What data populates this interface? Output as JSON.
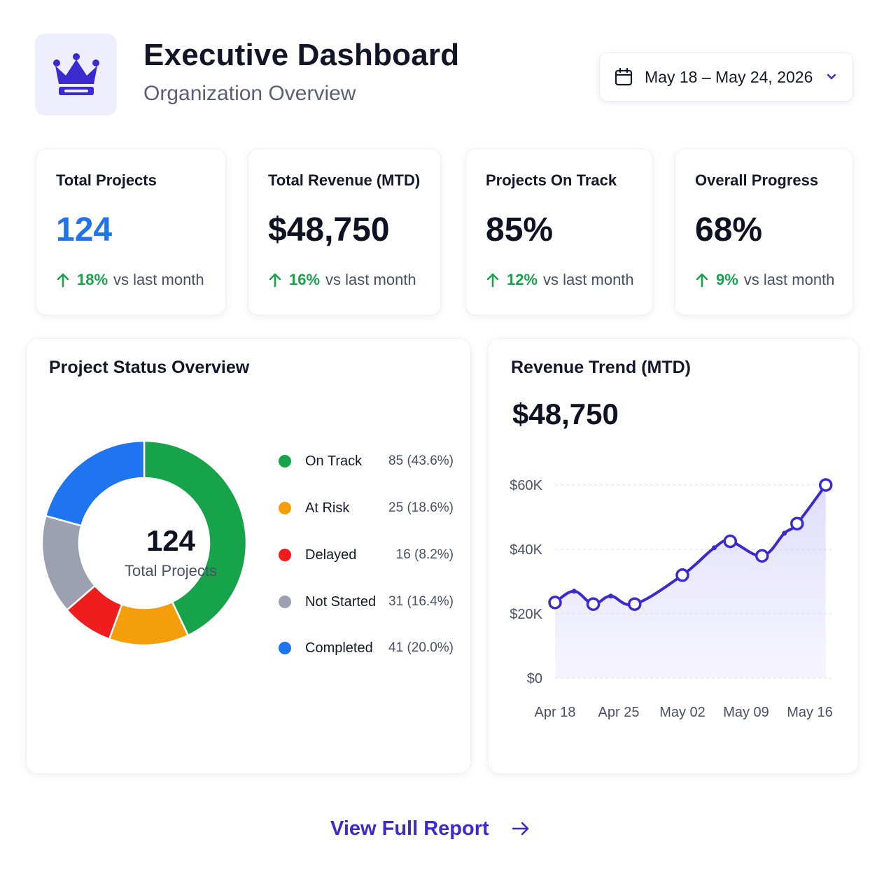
{
  "header": {
    "title": "Executive Dashboard",
    "subtitle": "Organization Overview",
    "logo_icon": "crown-icon",
    "brand_color": "#3b2ad0"
  },
  "date_picker": {
    "icon": "calendar-icon",
    "value": "May 18 – May 24, 2026",
    "chevron_icon": "chevron-down-icon"
  },
  "kpis": [
    {
      "label": "Total Projects",
      "value": "124",
      "delta": "18%",
      "delta_text": "vs last month",
      "value_color": "#2273f0"
    },
    {
      "label": "Total Revenue (MTD)",
      "value": "$48,750",
      "delta": "16%",
      "delta_text": "vs last month"
    },
    {
      "label": "Projects On Track",
      "value": "85%",
      "delta": "12%",
      "delta_text": "vs last month"
    },
    {
      "label": "Overall Progress",
      "value": "68%",
      "delta": "9%",
      "delta_text": "vs last month"
    }
  ],
  "status_overview": {
    "title": "Project Status Overview",
    "center_value": "124",
    "center_label": "Total Projects",
    "legend": [
      {
        "name": "On Track",
        "value": "85 (43.6%)",
        "color": "#16a34a"
      },
      {
        "name": "At Risk",
        "value": "25 (18.6%)",
        "color": "#f59e0b"
      },
      {
        "name": "Delayed",
        "value": "16 (8.2%)",
        "color": "#ef1d1d"
      },
      {
        "name": "Not Started",
        "value": "31 (16.4%)",
        "color": "#9ca0b0"
      },
      {
        "name": "Completed",
        "value": "41 (20.0%)",
        "color": "#1f74f0"
      }
    ]
  },
  "revenue_trend": {
    "title": "Revenue Trend (MTD)",
    "value": "$48,750",
    "line_color": "#3b2ad0"
  },
  "chart_data": [
    {
      "type": "pie",
      "title": "Project Status Overview",
      "categories": [
        "On Track",
        "At Risk",
        "Delayed",
        "Not Started",
        "Completed"
      ],
      "values": [
        85,
        25,
        16,
        31,
        41
      ],
      "colors": [
        "#16a34a",
        "#f59e0b",
        "#ef1d1d",
        "#9ca0b0",
        "#1f74f0"
      ],
      "donut": true
    },
    {
      "type": "area",
      "title": "Revenue Trend (MTD)",
      "x_ticks": [
        "Apr 18",
        "Apr 25",
        "May 02",
        "May 09",
        "May 16"
      ],
      "y_ticks": [
        "$0",
        "$20K",
        "$40K",
        "$60K"
      ],
      "ylim": [
        0,
        60000
      ],
      "grid": true,
      "points": [
        {
          "x": 0.0,
          "y": 23500,
          "marker": true
        },
        {
          "x": 0.6,
          "y": 27000,
          "marker": false
        },
        {
          "x": 1.2,
          "y": 23000,
          "marker": true
        },
        {
          "x": 1.75,
          "y": 25500,
          "marker": false
        },
        {
          "x": 2.5,
          "y": 23000,
          "marker": true
        },
        {
          "x": 4.0,
          "y": 32000,
          "marker": true
        },
        {
          "x": 5.0,
          "y": 40500,
          "marker": false
        },
        {
          "x": 5.5,
          "y": 42500,
          "marker": true
        },
        {
          "x": 6.5,
          "y": 38000,
          "marker": true
        },
        {
          "x": 7.2,
          "y": 45000,
          "marker": false
        },
        {
          "x": 7.6,
          "y": 48000,
          "marker": true
        },
        {
          "x": 8.5,
          "y": 60000,
          "marker": true
        }
      ]
    }
  ],
  "footer": {
    "link_label": "View Full Report",
    "link_icon": "arrow-right-icon"
  }
}
